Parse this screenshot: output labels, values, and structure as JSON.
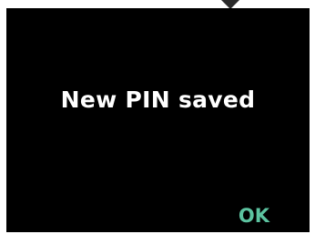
{
  "screen": {
    "message": "New PIN saved",
    "ok_label": "OK"
  },
  "colors": {
    "screen_background": "#000000",
    "message_text": "#ffffff",
    "ok_accent": "#5cc3a0",
    "pointer": "#2b2b2b"
  },
  "icons": {
    "pointer": "down-arrow-indicator-icon"
  }
}
